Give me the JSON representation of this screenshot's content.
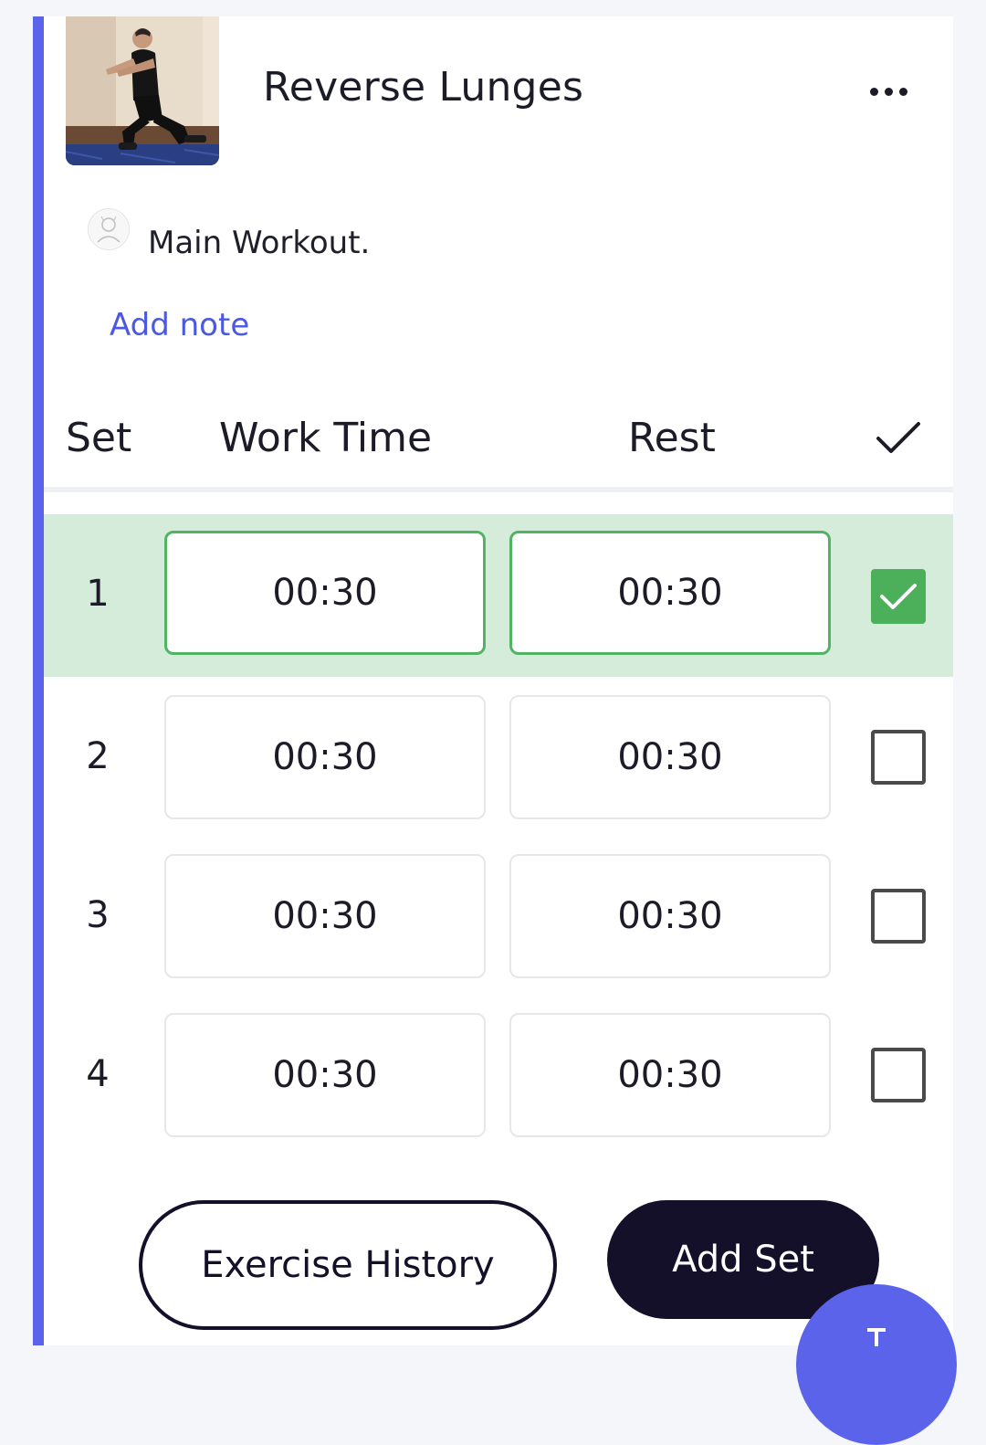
{
  "exercise": {
    "title": "Reverse Lunges",
    "more_icon": "more-horizontal-icon",
    "workout_name": "Main Workout.",
    "add_note_label": "Add note",
    "accent_color": "#5b63ea"
  },
  "table": {
    "headers": {
      "set": "Set",
      "work_time": "Work Time",
      "rest": "Rest",
      "check_icon": "checkmark-icon"
    },
    "rows": [
      {
        "set": "1",
        "work_time": "00:30",
        "rest": "00:30",
        "completed": true
      },
      {
        "set": "2",
        "work_time": "00:30",
        "rest": "00:30",
        "completed": false
      },
      {
        "set": "3",
        "work_time": "00:30",
        "rest": "00:30",
        "completed": false
      },
      {
        "set": "4",
        "work_time": "00:30",
        "rest": "00:30",
        "completed": false
      }
    ],
    "completed_row_color": "#d6ecdb",
    "completed_border_color": "#52b365"
  },
  "actions": {
    "history_label": "Exercise History",
    "add_set_label": "Add Set"
  }
}
